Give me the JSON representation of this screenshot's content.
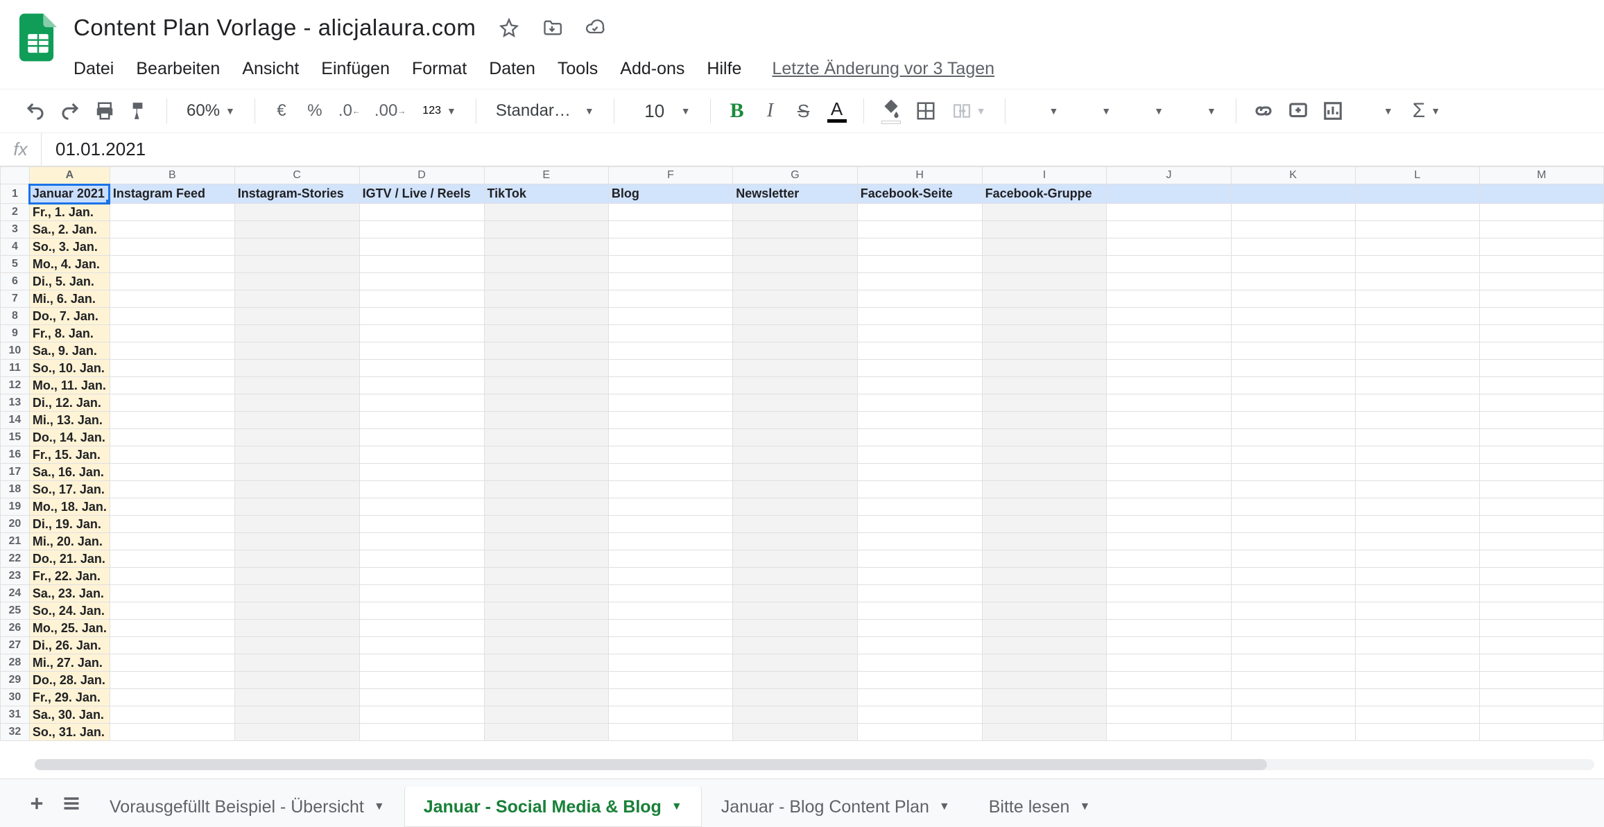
{
  "doc": {
    "title": "Content Plan Vorlage - alicjalaura.com"
  },
  "menu": {
    "items": [
      "Datei",
      "Bearbeiten",
      "Ansicht",
      "Einfügen",
      "Format",
      "Daten",
      "Tools",
      "Add-ons",
      "Hilfe"
    ],
    "last_edit": "Letzte Änderung vor 3 Tagen"
  },
  "toolbar": {
    "zoom": "60%",
    "number_fmt": "123",
    "font_name": "Standard (…",
    "font_size": "10"
  },
  "formula": {
    "fx": "fx",
    "value": "01.01.2021"
  },
  "grid": {
    "col_letters": [
      "A",
      "B",
      "C",
      "D",
      "E",
      "F",
      "G",
      "H",
      "I",
      "J",
      "K",
      "L",
      "M"
    ],
    "header_row": [
      "Januar 2021",
      "Instagram Feed",
      "Instagram-Stories",
      "IGTV / Live / Reels",
      "TikTok",
      "Blog",
      "Newsletter",
      "Facebook-Seite",
      "Facebook-Gruppe",
      "",
      "",
      "",
      ""
    ],
    "date_rows": [
      "Fr., 1. Jan.",
      "Sa., 2. Jan.",
      "So., 3. Jan.",
      "Mo., 4. Jan.",
      "Di., 5. Jan.",
      "Mi., 6. Jan.",
      "Do., 7. Jan.",
      "Fr., 8. Jan.",
      "Sa., 9. Jan.",
      "So., 10. Jan.",
      "Mo., 11. Jan.",
      "Di., 12. Jan.",
      "Mi., 13. Jan.",
      "Do., 14. Jan.",
      "Fr., 15. Jan.",
      "Sa., 16. Jan.",
      "So., 17. Jan.",
      "Mo., 18. Jan.",
      "Di., 19. Jan.",
      "Mi., 20. Jan.",
      "Do., 21. Jan.",
      "Fr., 22. Jan.",
      "Sa., 23. Jan.",
      "So., 24. Jan.",
      "Mo., 25. Jan.",
      "Di., 26. Jan.",
      "Mi., 27. Jan.",
      "Do., 28. Jan.",
      "Fr., 29. Jan.",
      "Sa., 30. Jan.",
      "So., 31. Jan."
    ],
    "alt_cols": [
      2,
      4,
      6,
      8
    ]
  },
  "sheets": {
    "tabs": [
      {
        "label": "Vorausgefüllt Beispiel - Übersicht",
        "active": false
      },
      {
        "label": "Januar - Social Media & Blog",
        "active": true
      },
      {
        "label": "Januar - Blog Content Plan",
        "active": false
      },
      {
        "label": "Bitte lesen",
        "active": false
      }
    ]
  }
}
